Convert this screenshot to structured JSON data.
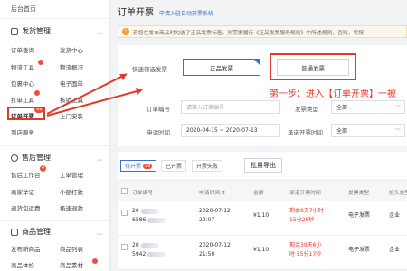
{
  "sidebar": {
    "top": "后台首页",
    "sections": [
      {
        "title": "发货管理",
        "items": [
          [
            "订单查询",
            "发货中心"
          ],
          [
            "物流工具",
            "物流概况"
          ],
          [
            "包裹中心",
            "电子面单"
          ],
          [
            "打单工具",
            "核销工具"
          ],
          [
            "订单开票",
            "上门安装"
          ],
          [
            "到店服务",
            ""
          ]
        ]
      },
      {
        "title": "售后管理",
        "items": [
          [
            "售后工作台",
            "工单管理"
          ],
          [
            "商家举证",
            "小额打款"
          ],
          [
            "退货包运费",
            "极速退款"
          ]
        ]
      },
      {
        "title": "商品管理",
        "items": [
          [
            "发布新商品",
            "商品列表"
          ],
          [
            "商品体检",
            "商品素材"
          ]
        ]
      }
    ],
    "badges": {
      "orders_invoice": "99",
      "after_sales": "4"
    }
  },
  "header": {
    "title": "订单开票",
    "subtitle": "申请入驻自动开票系统"
  },
  "notice": {
    "text": "若您在发布商品时勾选了正品发票标签，则需要履行《正品发票服务规则》中所述规则，否则，将按"
  },
  "filter": {
    "quick_label": "快速筛选发票",
    "quick_options": [
      "正品发票",
      "普通发票"
    ],
    "step_annotation": "第一步：进入【订单开票】一被",
    "fields": {
      "order_no_label": "订单编号",
      "order_no_placeholder": "请输入订单编号",
      "invoice_type_label": "发票类型",
      "invoice_type_value": "全部",
      "apply_time_label": "申请时间",
      "apply_time_value": "2020-04-15 ~ 2020-07-13",
      "deadline_label": "承诺开票时间",
      "deadline_value": "全部"
    }
  },
  "tabs": {
    "items": [
      {
        "label": "待开票",
        "badge": "99"
      },
      {
        "label": "已开票",
        "badge": ""
      },
      {
        "label": "开票失败",
        "badge": ""
      }
    ],
    "export_label": "批量导出"
  },
  "table": {
    "headers": [
      "订单编号",
      "申请时间 ↕",
      "金额",
      "承诺开票时间",
      "发票类型",
      "抬头类型"
    ],
    "rows": [
      {
        "order": [
          "20",
          "6586"
        ],
        "time": [
          "2020-07-12",
          "22:07"
        ],
        "amount": "¥1.10",
        "deadline": [
          "剩余9天7小时",
          "15分28秒"
        ],
        "type": "电子发票",
        "title_type": "企业"
      },
      {
        "order": [
          "20",
          "5942"
        ],
        "time": [
          "2020-07-12",
          "21:50"
        ],
        "amount": "¥1.10",
        "deadline": [
          "剩余39天6小",
          "时 55分17秒"
        ],
        "type": "电子发票",
        "title_type": "企业"
      }
    ]
  },
  "colors": {
    "accent": "#3b6fd6",
    "annotation": "#e23a2a",
    "badge": "#e9513f"
  }
}
